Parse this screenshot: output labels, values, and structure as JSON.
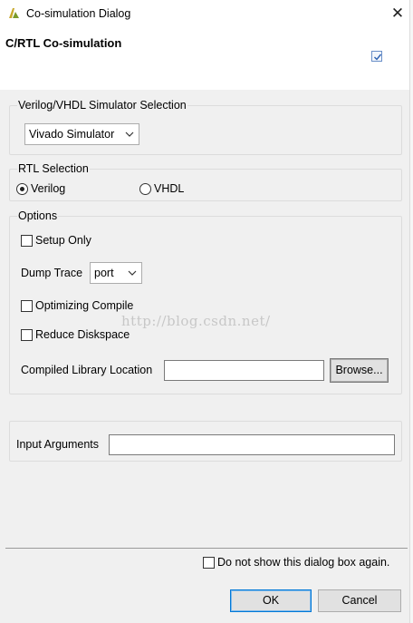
{
  "window": {
    "title": "Co-simulation Dialog",
    "close_glyph": "✕"
  },
  "header": {
    "title": "C/RTL Co-simulation",
    "icon": "checkbox-icon"
  },
  "simulator_group": {
    "label": "Verilog/VHDL Simulator Selection",
    "selected": "Vivado Simulator"
  },
  "rtl_group": {
    "label": "RTL Selection",
    "options": [
      {
        "label": "Verilog",
        "checked": true
      },
      {
        "label": "VHDL",
        "checked": false
      }
    ]
  },
  "options_group": {
    "label": "Options",
    "setup_only": {
      "label": "Setup Only",
      "checked": false
    },
    "dump_trace": {
      "label": "Dump Trace",
      "selected": "port"
    },
    "optimizing_compile": {
      "label": "Optimizing Compile",
      "checked": false
    },
    "reduce_diskspace": {
      "label": "Reduce Diskspace",
      "checked": false
    },
    "compiled_library": {
      "label": "Compiled Library Location",
      "value": "",
      "browse_label": "Browse..."
    }
  },
  "watermark": "http://blog.csdn.net/",
  "input_arguments": {
    "label": "Input Arguments",
    "value": ""
  },
  "footer": {
    "dont_show": {
      "label": "Do not show this dialog box again.",
      "checked": false
    },
    "ok_label": "OK",
    "cancel_label": "Cancel"
  },
  "colors": {
    "accent": "#0078d7",
    "background": "#f0f0f0",
    "group_border": "#dcdcdc"
  }
}
